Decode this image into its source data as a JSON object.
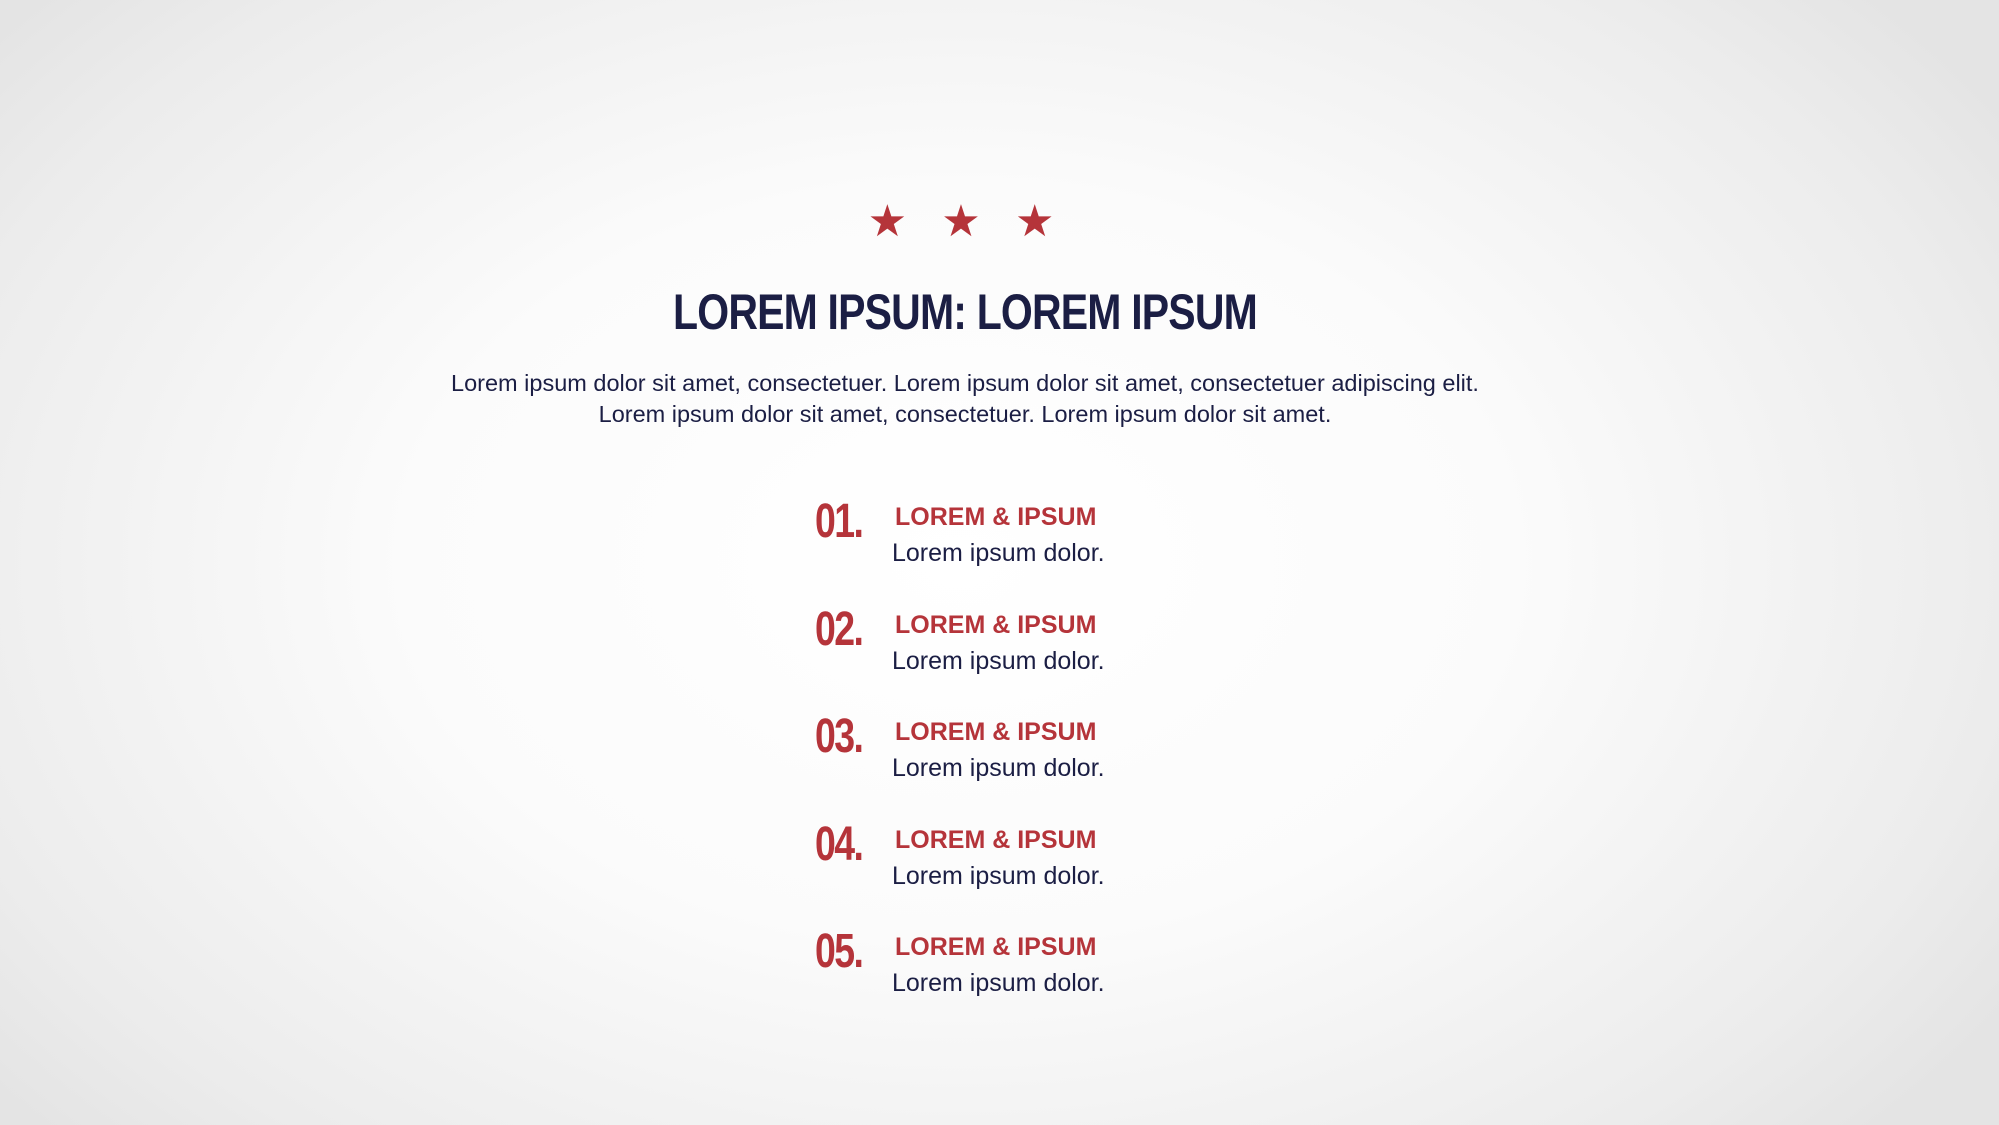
{
  "colors": {
    "accent": "#b5343a",
    "text": "#1b1e44"
  },
  "stars": [
    "★",
    "★",
    "★"
  ],
  "title": "LOREM IPSUM:  LOREM IPSUM",
  "intro": "Lorem ipsum dolor sit amet, consectetuer. Lorem ipsum dolor sit amet, consectetuer adipiscing elit. Lorem ipsum dolor sit amet, consectetuer. Lorem ipsum dolor sit amet.",
  "items": [
    {
      "number": "01.",
      "heading": "LOREM & IPSUM",
      "text": "Lorem ipsum dolor."
    },
    {
      "number": "02.",
      "heading": "LOREM & IPSUM",
      "text": "Lorem ipsum dolor."
    },
    {
      "number": "03.",
      "heading": "LOREM & IPSUM",
      "text": "Lorem ipsum dolor."
    },
    {
      "number": "04.",
      "heading": "LOREM & IPSUM",
      "text": "Lorem ipsum dolor."
    },
    {
      "number": "05.",
      "heading": "LOREM & IPSUM",
      "text": "Lorem ipsum dolor."
    }
  ]
}
